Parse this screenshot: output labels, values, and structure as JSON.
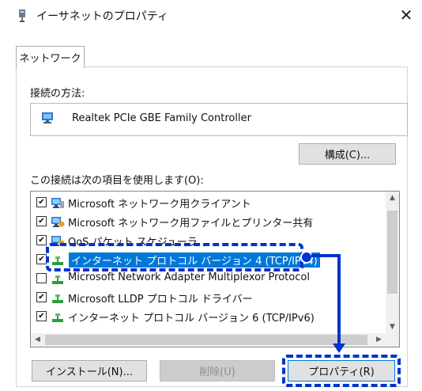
{
  "window": {
    "title": "イーサネットのプロパティ",
    "close_glyph": "✕",
    "title_icon": "network-adapter-icon"
  },
  "tabs": [
    {
      "label": "ネットワーク",
      "active": true
    }
  ],
  "connection": {
    "label": "接続の方法:",
    "adapter_name": "Realtek PCIe GBE Family Controller",
    "adapter_icon": "network-card-icon",
    "configure_button": "構成(C)..."
  },
  "items_section": {
    "label": "この接続は次の項目を使用します(O):",
    "items": [
      {
        "checked": true,
        "icon": "client-icon",
        "label": "Microsoft ネットワーク用クライアント",
        "selected": false
      },
      {
        "checked": true,
        "icon": "service-icon",
        "label": "Microsoft ネットワーク用ファイルとプリンター共有",
        "selected": false
      },
      {
        "checked": true,
        "icon": "service-icon",
        "label": "QoS パケット スケジューラ",
        "selected": false
      },
      {
        "checked": true,
        "icon": "protocol-icon",
        "label": "インターネット プロトコル バージョン 4 (TCP/IPv4)",
        "selected": true
      },
      {
        "checked": false,
        "icon": "protocol-icon",
        "label": "Microsoft Network Adapter Multiplexor Protocol",
        "selected": false
      },
      {
        "checked": true,
        "icon": "protocol-icon",
        "label": "Microsoft LLDP プロトコル ドライバー",
        "selected": false
      },
      {
        "checked": true,
        "icon": "protocol-icon",
        "label": "インターネット プロトコル バージョン 6 (TCP/IPv6)",
        "selected": false
      }
    ],
    "check_glyph": "✔",
    "scroll_up": "▲",
    "scroll_down": "▼",
    "scroll_left": "◀",
    "scroll_right": "▶"
  },
  "buttons": {
    "install": "インストール(N)...",
    "uninstall": "削除(U)",
    "properties": "プロパティ(R)"
  },
  "colors": {
    "selection": "#0078d7",
    "annotation": "#0033cc"
  }
}
